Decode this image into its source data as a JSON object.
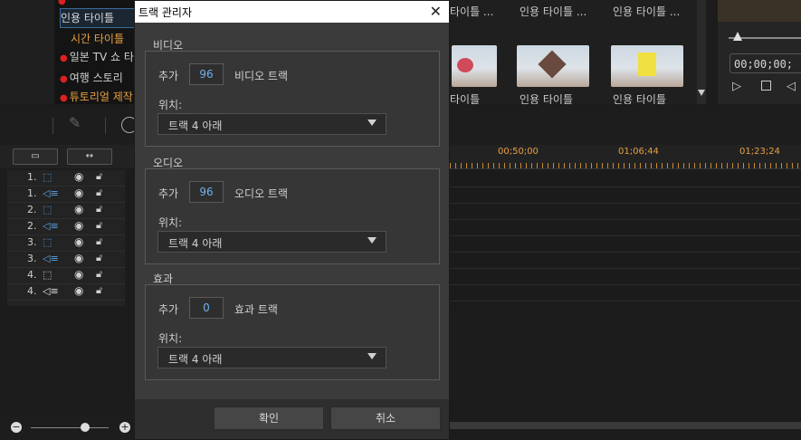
{
  "library": {
    "tree_items": [
      {
        "label": "인용 타이틀",
        "style": "sel"
      },
      {
        "label": "시간 타이틀",
        "style": "orange"
      },
      {
        "label": "일본 TV 쇼 타",
        "style": "dot"
      },
      {
        "label": "여행 스토리",
        "style": "dot"
      },
      {
        "label": "튜토리얼 제작",
        "style": "dot"
      }
    ],
    "thumb_titles": [
      "타이틀 ...",
      "인용 타이틀 ...",
      "인용 타이틀 ..."
    ],
    "thumb_subtitles": [
      "타이틀",
      "인용 타이틀",
      "인용 타이틀"
    ]
  },
  "preview": {
    "timecode": "00;00;00;"
  },
  "timeline": {
    "ruler_labels": [
      "00;50;00",
      "01;06;44",
      "01;23;24"
    ],
    "tracks": [
      {
        "num": "1.",
        "type": "video"
      },
      {
        "num": "1.",
        "type": "audio"
      },
      {
        "num": "2.",
        "type": "video"
      },
      {
        "num": "2.",
        "type": "audio"
      },
      {
        "num": "3.",
        "type": "video"
      },
      {
        "num": "3.",
        "type": "audio"
      },
      {
        "num": "4.",
        "type": "video"
      },
      {
        "num": "4.",
        "type": "audio"
      }
    ]
  },
  "dialog": {
    "title": "트랙 관리자",
    "video": {
      "label": "비디오",
      "add": "추가",
      "count": "96",
      "track_label": "비디오 트랙",
      "pos_label": "위치:",
      "pos_value": "트랙 4 아래"
    },
    "audio": {
      "label": "오디오",
      "add": "추가",
      "count": "96",
      "track_label": "오디오 트랙",
      "pos_label": "위치:",
      "pos_value": "트랙 4 아래"
    },
    "effect": {
      "label": "효과",
      "add": "추가",
      "count": "0",
      "track_label": "효과 트랙",
      "pos_label": "위치:",
      "pos_value": "트랙 4 아래"
    },
    "ok": "확인",
    "cancel": "취소"
  },
  "colors": {
    "accent": "#6fb0f0",
    "ruler": "#e8a040"
  }
}
